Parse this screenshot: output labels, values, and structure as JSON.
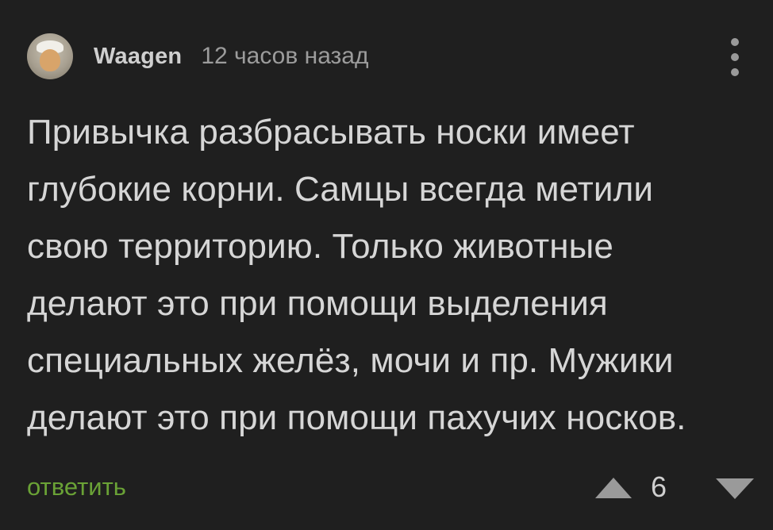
{
  "comment": {
    "author": "Waagen",
    "time": "12 часов назад",
    "text_lines": [
      "Привычка разбрасывать носки имеет",
      "глубокие корни. Самцы всегда метили",
      "свою территорию. Только животные",
      "делают это при помощи выделения",
      "специальных желёз, мочи и пр. Мужики",
      "делают это при помощи пахучих носков."
    ],
    "reply_label": "ответить",
    "rating": "6"
  },
  "icons": {
    "more": "more-vertical-icon",
    "upvote": "triangle-up-icon",
    "downvote": "triangle-down-icon"
  },
  "colors": {
    "background": "#1f1f1f",
    "text": "#d6d6d6",
    "reply": "#6aa236",
    "icon": "#9a9a9a"
  }
}
